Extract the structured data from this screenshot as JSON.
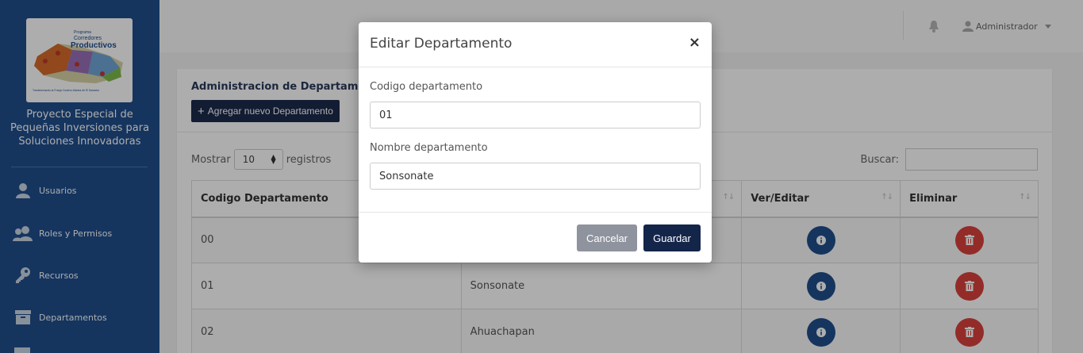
{
  "sidebar": {
    "logo": {
      "line1": "Programa",
      "line2": "Corredores",
      "line3": "Productivos",
      "tagline": "Transformando la Franja Costero-Marina de El Salvador"
    },
    "org_name": [
      "Proyecto Especial de",
      "Pequeñas Inversiones para",
      "Soluciones Innovadoras"
    ],
    "items": [
      {
        "label": "Usuarios",
        "icon": "user-icon"
      },
      {
        "label": "Roles y Permisos",
        "icon": "users-icon"
      },
      {
        "label": "Recursos",
        "icon": "key-icon"
      },
      {
        "label": "Departamentos",
        "icon": "archive-icon"
      }
    ]
  },
  "topbar": {
    "user_label": "Administrador",
    "icons": [
      "bell-icon",
      "user-icon",
      "caret-down-icon"
    ]
  },
  "panel": {
    "title": "Administracion de Departamentos",
    "add_button_label": "Agregar nuevo Departamento",
    "length_prefix": "Mostrar",
    "length_value": "10",
    "length_suffix": "registros",
    "search_label": "Buscar:",
    "table": {
      "columns": [
        "Codigo Departamento",
        "",
        "Ver/Editar",
        "Eliminar"
      ],
      "rows": [
        {
          "codigo": "00",
          "nombre": ""
        },
        {
          "codigo": "01",
          "nombre": "Sonsonate"
        },
        {
          "codigo": "02",
          "nombre": "Ahuachapan"
        }
      ]
    }
  },
  "modal": {
    "title": "Editar Departamento",
    "close_glyph": "×",
    "codigo_label": "Codigo departamento",
    "codigo_value": "01",
    "nombre_label": "Nombre departamento",
    "nombre_value": "Sonsonate",
    "cancel_label": "Cancelar",
    "save_label": "Guardar"
  },
  "colors": {
    "sidebar_bg": "#1f4e8c",
    "primary_dark": "#14254a",
    "danger": "#d9423b",
    "cancel_gray": "#8f939e"
  }
}
